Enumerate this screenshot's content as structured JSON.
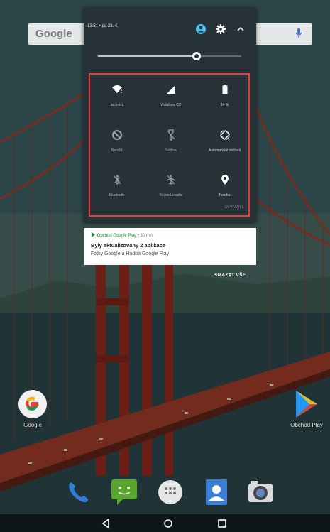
{
  "home": {
    "search_brand": "Google",
    "apps": [
      {
        "label": "Google",
        "icon": "google-app-icon"
      },
      {
        "label": "Obchod Play",
        "icon": "play-store-icon"
      }
    ],
    "dock": [
      "phone-icon",
      "hangouts-icon",
      "app-drawer-icon",
      "contacts-icon",
      "camera-icon"
    ]
  },
  "shade": {
    "clock": "13:51 • po 23. 4.",
    "brightness_level": 0.69,
    "tiles": [
      {
        "label": "technici",
        "icon": "wifi-icon",
        "active": true
      },
      {
        "label": "Vodafone CZ",
        "icon": "cell-signal-icon",
        "active": true
      },
      {
        "label": "84 %",
        "icon": "battery-icon",
        "active": true
      },
      {
        "label": "Nerušit",
        "icon": "do-not-disturb-off-icon",
        "active": false
      },
      {
        "label": "Svítilna",
        "icon": "flashlight-off-icon",
        "active": false
      },
      {
        "label": "Automatické otáčení",
        "icon": "auto-rotate-icon",
        "active": true
      },
      {
        "label": "Bluetooth",
        "icon": "bluetooth-off-icon",
        "active": false
      },
      {
        "label": "Režim Letadlo",
        "icon": "airplane-mode-off-icon",
        "active": false
      },
      {
        "label": "Poloha",
        "icon": "location-icon",
        "active": true
      }
    ],
    "edit_label": "UPRAVIT",
    "highlight_color": "#e53935"
  },
  "notification": {
    "app_name": "Obchod Google Play",
    "time": " • 30 min",
    "title": "Byly aktualizovány 2 aplikace",
    "body": "Fotky Google a Hudba Google Play"
  },
  "clear_all_label": "SMAZAT VŠE"
}
